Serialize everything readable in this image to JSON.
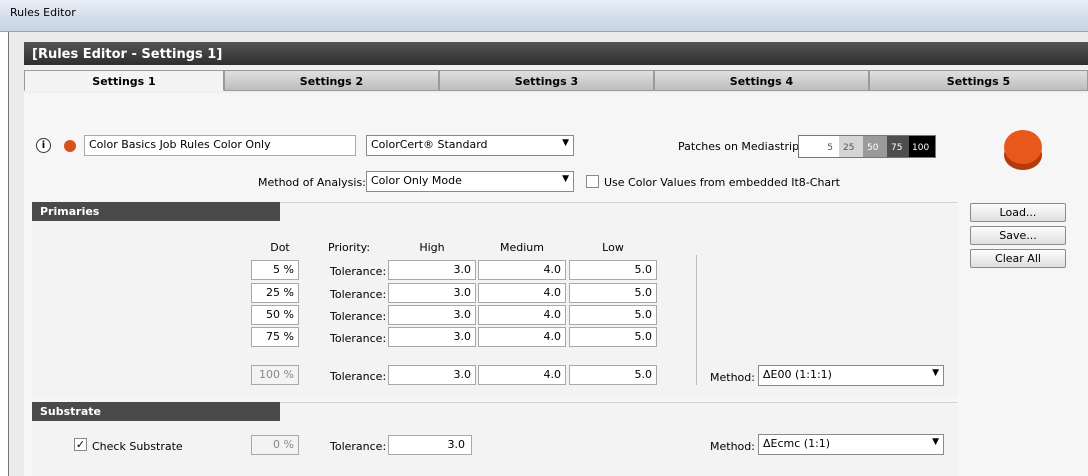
{
  "window": {
    "os_title": "Rules Editor",
    "header_title": "[Rules Editor - Settings 1]"
  },
  "tabs": [
    "Settings 1",
    "Settings 2",
    "Settings 3",
    "Settings 4",
    "Settings 5"
  ],
  "top": {
    "job_name": "Color Basics Job Rules Color Only",
    "standard": "ColorCert® Standard",
    "patches_label": "Patches on Mediastrip:",
    "patch_values": [
      "5",
      "25",
      "50",
      "75",
      "100"
    ],
    "method_analysis_label": "Method of Analysis:",
    "method_analysis_value": "Color Only Mode",
    "embedded_checkbox_label": "Use Color Values from embedded It8-Chart",
    "embedded_checked": false,
    "info_icon": "ⓘ"
  },
  "primaries": {
    "title": "Primaries",
    "dot_header": "Dot",
    "priority_header": "Priority:",
    "high_header": "High",
    "medium_header": "Medium",
    "low_header": "Low",
    "tolerance_label": "Tolerance:",
    "rows": [
      {
        "dot": "5 %",
        "high": "3.0",
        "medium": "4.0",
        "low": "5.0"
      },
      {
        "dot": "25 %",
        "high": "3.0",
        "medium": "4.0",
        "low": "5.0"
      },
      {
        "dot": "50 %",
        "high": "3.0",
        "medium": "4.0",
        "low": "5.0"
      },
      {
        "dot": "75 %",
        "high": "3.0",
        "medium": "4.0",
        "low": "5.0"
      }
    ],
    "solid_row": {
      "dot": "100 %",
      "high": "3.0",
      "medium": "4.0",
      "low": "5.0"
    },
    "method_label": "Method:",
    "method_value": "ΔE00 (1:1:1)"
  },
  "substrate": {
    "title": "Substrate",
    "check_label": "Check Substrate",
    "checked": true,
    "dot": "0 %",
    "tolerance_label": "Tolerance:",
    "tolerance": "3.0",
    "method_label": "Method:",
    "method_value": "ΔEcmc (1:1)"
  },
  "buttons": {
    "load": "Load...",
    "save": "Save...",
    "clear": "Clear All"
  },
  "colors": {
    "accent": "#e05a1c",
    "header": "#3a3a3a"
  }
}
